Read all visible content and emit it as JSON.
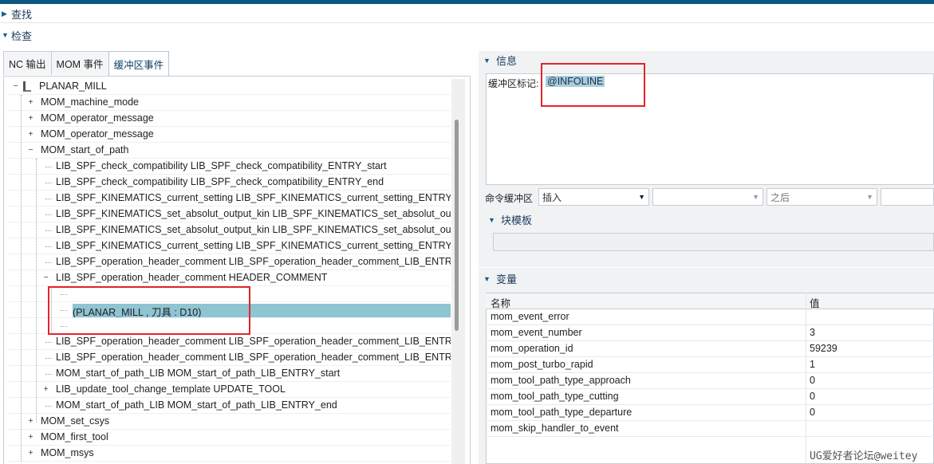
{
  "sections": {
    "find": "查找",
    "inspect": "检查"
  },
  "tabs": [
    "NC 输出",
    "MOM 事件",
    "缓冲区事件"
  ],
  "tree": [
    {
      "label": "PLANAR_MILL",
      "toggle": "−",
      "level": 0,
      "icon": "operation-icon"
    },
    {
      "label": "MOM_machine_mode",
      "toggle": "+",
      "level": 1
    },
    {
      "label": "MOM_operator_message",
      "toggle": "+",
      "level": 1
    },
    {
      "label": "MOM_operator_message",
      "toggle": "+",
      "level": 1
    },
    {
      "label": "MOM_start_of_path",
      "toggle": "−",
      "level": 1
    },
    {
      "label": "LIB_SPF_check_compatibility LIB_SPF_check_compatibility_ENTRY_start",
      "toggle": "",
      "level": 2
    },
    {
      "label": "LIB_SPF_check_compatibility LIB_SPF_check_compatibility_ENTRY_end",
      "toggle": "",
      "level": 2
    },
    {
      "label": "LIB_SPF_KINEMATICS_current_setting LIB_SPF_KINEMATICS_current_setting_ENTRY_start",
      "toggle": "",
      "level": 2
    },
    {
      "label": "LIB_SPF_KINEMATICS_set_absolut_output_kin LIB_SPF_KINEMATICS_set_absolut_output_kin_ENTRY_start",
      "toggle": "",
      "level": 2
    },
    {
      "label": "LIB_SPF_KINEMATICS_set_absolut_output_kin LIB_SPF_KINEMATICS_set_absolut_output_kin_ENTRY_end",
      "toggle": "",
      "level": 2
    },
    {
      "label": "LIB_SPF_KINEMATICS_current_setting LIB_SPF_KINEMATICS_current_setting_ENTRY_end",
      "toggle": "",
      "level": 2
    },
    {
      "label": "LIB_SPF_operation_header_comment LIB_SPF_operation_header_comment_LIB_ENTRY_start",
      "toggle": "",
      "level": 2
    },
    {
      "label": "LIB_SPF_operation_header_comment HEADER_COMMENT",
      "toggle": "−",
      "level": 2
    },
    {
      "label": "",
      "toggle": "",
      "level": 3
    },
    {
      "label": "(PLANAR_MILL , 刀具 : D10)",
      "toggle": "",
      "level": 3,
      "selected": true
    },
    {
      "label": "",
      "toggle": "",
      "level": 3
    },
    {
      "label": "LIB_SPF_operation_header_comment LIB_SPF_operation_header_comment_LIB_ENTRY_end",
      "toggle": "",
      "level": 2
    },
    {
      "label": "LIB_SPF_operation_header_comment LIB_SPF_operation_header_comment_LIB_ENTRY_end",
      "toggle": "",
      "level": 2
    },
    {
      "label": "MOM_start_of_path_LIB MOM_start_of_path_LIB_ENTRY_start",
      "toggle": "",
      "level": 2
    },
    {
      "label": "LIB_update_tool_change_template UPDATE_TOOL",
      "toggle": "+",
      "level": 2
    },
    {
      "label": "MOM_start_of_path_LIB MOM_start_of_path_LIB_ENTRY_end",
      "toggle": "",
      "level": 2
    },
    {
      "label": "MOM_set_csys",
      "toggle": "+",
      "level": 1
    },
    {
      "label": "MOM_first_tool",
      "toggle": "+",
      "level": 1
    },
    {
      "label": "MOM_msys",
      "toggle": "+",
      "level": 1
    }
  ],
  "info": {
    "header": "信息",
    "buffer_label": "缓冲区标记:",
    "buffer_value": "@INFOLINE",
    "cmd_label": "命令缓冲区",
    "combo_insert": "插入",
    "combo_after": "之后",
    "block_header": "块模板"
  },
  "variables": {
    "header": "变量",
    "col_name": "名称",
    "col_value": "值",
    "rows": [
      {
        "name": "mom_event_error",
        "value": ""
      },
      {
        "name": "mom_event_number",
        "value": "3"
      },
      {
        "name": "mom_operation_id",
        "value": "59239"
      },
      {
        "name": "mom_post_turbo_rapid",
        "value": "1"
      },
      {
        "name": "mom_tool_path_type_approach",
        "value": "0"
      },
      {
        "name": "mom_tool_path_type_cutting",
        "value": "0"
      },
      {
        "name": "mom_tool_path_type_departure",
        "value": "0"
      },
      {
        "name": "mom_skip_handler_to_event",
        "value": ""
      }
    ]
  },
  "watermark": "UG爱好者论坛@weitey"
}
